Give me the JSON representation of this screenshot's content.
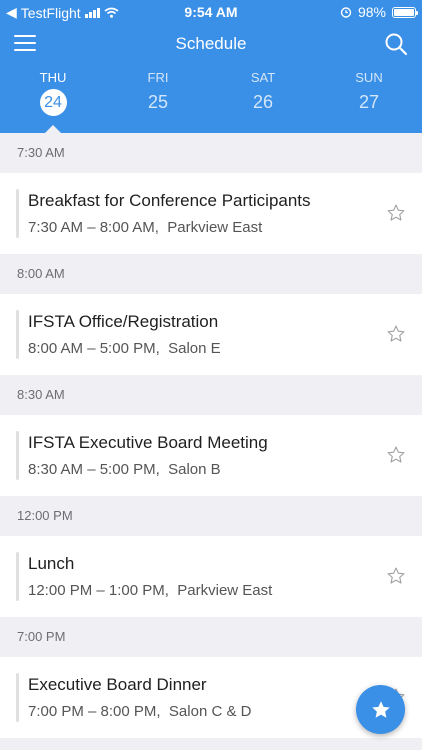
{
  "status_bar": {
    "carrier": "TestFlight",
    "time": "9:54 AM",
    "battery": "98%"
  },
  "navbar": {
    "title": "Schedule"
  },
  "days": [
    {
      "dow": "THU",
      "num": "24"
    },
    {
      "dow": "FRI",
      "num": "25"
    },
    {
      "dow": "SAT",
      "num": "26"
    },
    {
      "dow": "SUN",
      "num": "27"
    }
  ],
  "schedule": [
    {
      "time": "7:30 AM",
      "name": "Breakfast for Conference Participants",
      "range": "7:30 AM – 8:00 AM,",
      "room": "Parkview East"
    },
    {
      "time": "8:00 AM",
      "name": "IFSTA Office/Registration",
      "range": "8:00 AM – 5:00 PM,",
      "room": "Salon E"
    },
    {
      "time": "8:30 AM",
      "name": "IFSTA Executive Board Meeting",
      "range": "8:30 AM – 5:00 PM,",
      "room": "Salon B"
    },
    {
      "time": "12:00 PM",
      "name": "Lunch",
      "range": "12:00 PM – 1:00 PM,",
      "room": "Parkview East"
    },
    {
      "time": "7:00 PM",
      "name": "Executive Board Dinner",
      "range": "7:00 PM – 8:00 PM,",
      "room": "Salon C & D"
    }
  ],
  "colors": {
    "accent": "#3a8fe6",
    "background": "#efeff4"
  }
}
